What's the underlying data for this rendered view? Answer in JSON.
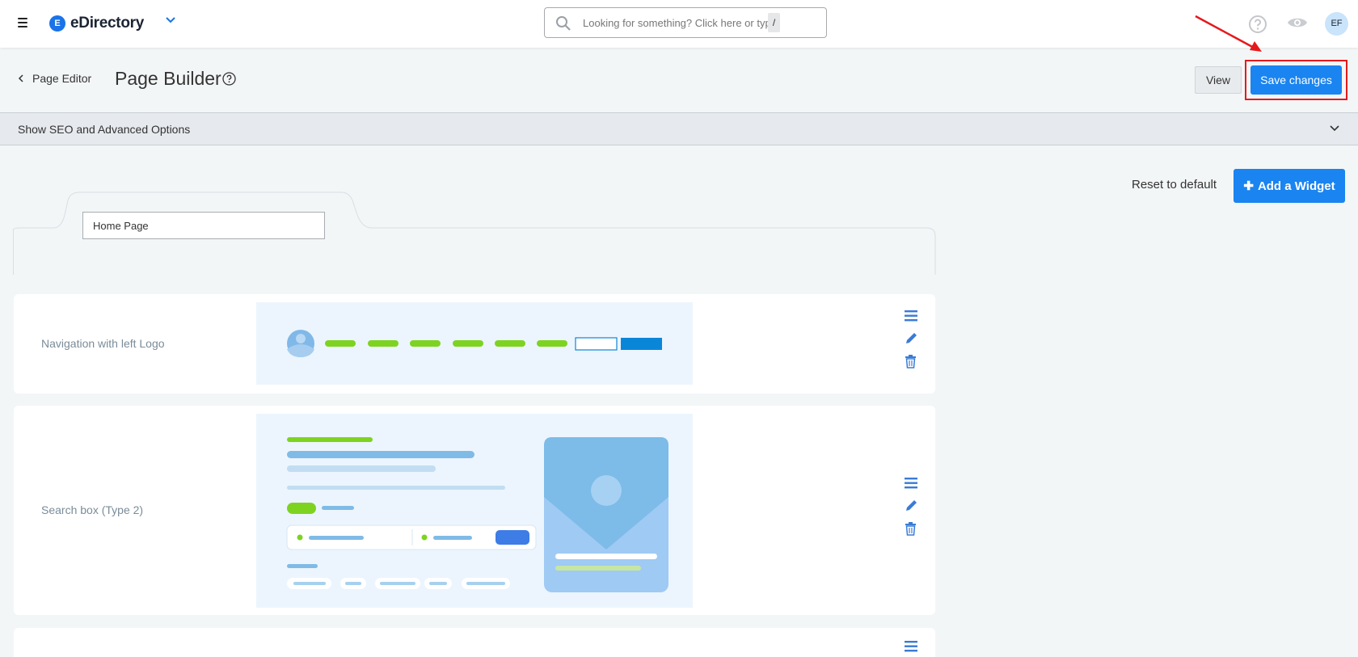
{
  "topbar": {
    "brand_letter": "E",
    "brand_name": "eDirectory",
    "search_placeholder": "Looking for something? Click here or type",
    "search_shortcut": "/",
    "avatar_initials": "EF"
  },
  "header": {
    "back_label": "Page Editor",
    "title": "Page Builder",
    "view_label": "View",
    "save_label": "Save changes"
  },
  "seo": {
    "label": "Show SEO and Advanced Options"
  },
  "actions": {
    "reset_label": "Reset to default",
    "add_widget_label": "Add a Widget"
  },
  "page_tab": {
    "name_value": "Home Page"
  },
  "widgets": [
    {
      "label": "Navigation with left Logo"
    },
    {
      "label": "Search box (Type 2)"
    },
    {
      "label": ""
    }
  ],
  "colors": {
    "primary": "#1a84f0",
    "annotation": "#e5191c",
    "preview_green": "#7ed321",
    "preview_blue": "#0a86d8"
  }
}
